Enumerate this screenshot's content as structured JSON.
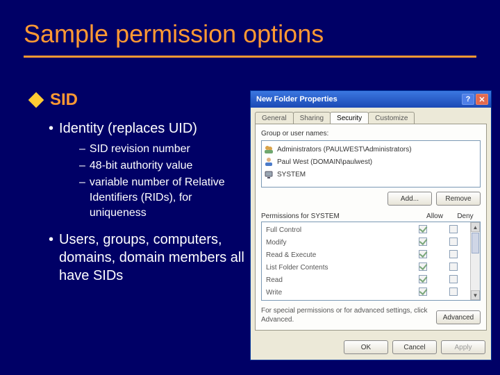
{
  "slide": {
    "title": "Sample permission options",
    "heading": "SID",
    "bullet1": "Identity (replaces UID)",
    "sub": [
      "SID revision number",
      " 48-bit authority value",
      "variable number of Relative Identifiers (RIDs), for uniqueness"
    ],
    "bullet2": "Users, groups, computers, domains, domain members all have SIDs"
  },
  "dialog": {
    "title": "New Folder Properties",
    "tabs": {
      "general": "General",
      "sharing": "Sharing",
      "security": "Security",
      "customize": "Customize"
    },
    "group_label": "Group or user names:",
    "principals": [
      {
        "icon": "group",
        "text": "Administrators (PAULWEST\\Administrators)"
      },
      {
        "icon": "user",
        "text": "Paul West (DOMAIN\\paulwest)"
      },
      {
        "icon": "system",
        "text": "SYSTEM"
      }
    ],
    "add_btn": "Add...",
    "remove_btn": "Remove",
    "perm_for": "Permissions for SYSTEM",
    "col_allow": "Allow",
    "col_deny": "Deny",
    "perms": [
      {
        "name": "Full Control",
        "allow": true,
        "deny": false
      },
      {
        "name": "Modify",
        "allow": true,
        "deny": false
      },
      {
        "name": "Read & Execute",
        "allow": true,
        "deny": false
      },
      {
        "name": "List Folder Contents",
        "allow": true,
        "deny": false
      },
      {
        "name": "Read",
        "allow": true,
        "deny": false
      },
      {
        "name": "Write",
        "allow": true,
        "deny": false
      }
    ],
    "hint": "For special permissions or for advanced settings, click Advanced.",
    "advanced_btn": "Advanced",
    "ok_btn": "OK",
    "cancel_btn": "Cancel",
    "apply_btn": "Apply"
  }
}
